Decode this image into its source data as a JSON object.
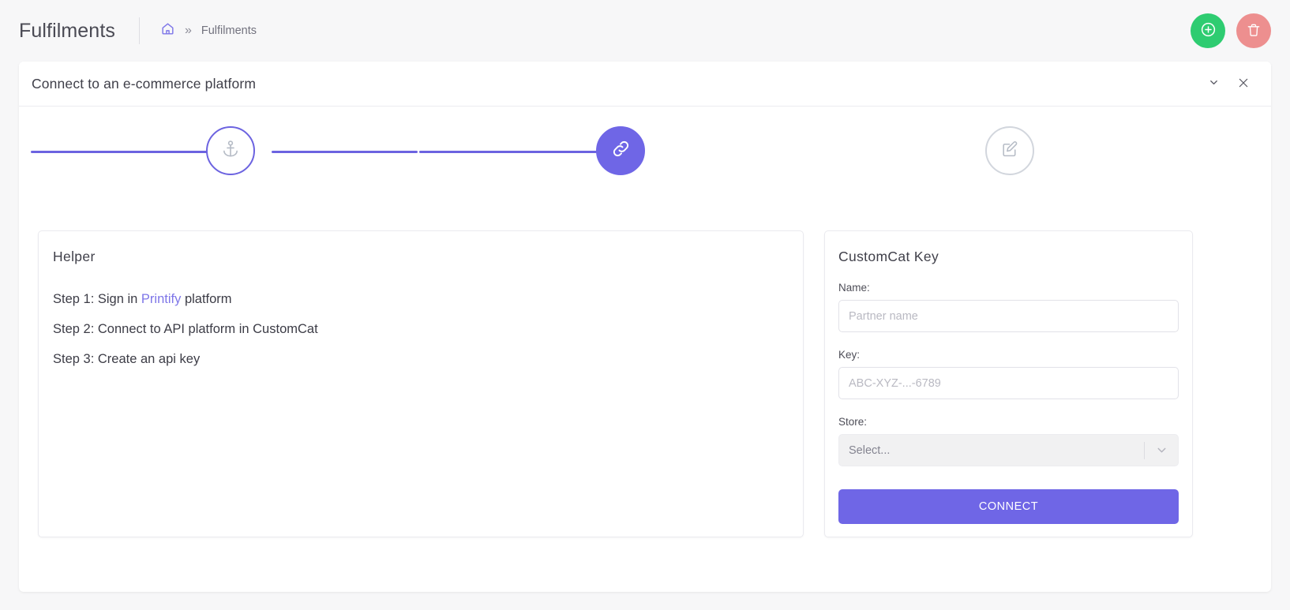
{
  "header": {
    "title": "Fulfilments",
    "breadcrumb": {
      "home_icon": "home-icon",
      "separator": "»",
      "current": "Fulfilments"
    },
    "actions": {
      "add_label": "add-circle-icon",
      "delete_label": "trash-icon"
    }
  },
  "card": {
    "title": "Connect to an e-commerce platform",
    "collapse_icon": "chevron-down-icon",
    "close_icon": "close-icon"
  },
  "stepper": {
    "steps": [
      {
        "id": "step-anchor",
        "icon": "anchor-icon",
        "state": "active-outline"
      },
      {
        "id": "step-link",
        "icon": "link-icon",
        "state": "active-filled"
      },
      {
        "id": "step-edit",
        "icon": "edit-icon",
        "state": "inactive"
      }
    ]
  },
  "helper": {
    "title": "Helper",
    "steps": [
      {
        "prefix": "Step 1: Sign in ",
        "link": "Printify",
        "suffix": " platform"
      },
      {
        "prefix": "Step 2: Connect to API platform in CustomCat",
        "link": "",
        "suffix": ""
      },
      {
        "prefix": "Step 3: Create an api key",
        "link": "",
        "suffix": ""
      }
    ]
  },
  "key_form": {
    "title": "CustomCat Key",
    "name_label": "Name:",
    "name_value": "",
    "name_placeholder": "Partner name",
    "key_label": "Key:",
    "key_value": "",
    "key_placeholder": "ABC-XYZ-...-6789",
    "store_label": "Store:",
    "store_value": "Select...",
    "store_arrow_icon": "chevron-down-icon",
    "connect_label": "CONNECT"
  },
  "colors": {
    "accent_purple": "#6f66e6",
    "link_purple": "#7e76e8",
    "add_green": "#2ecc71",
    "delete_red": "#ed8f8f",
    "page_bg": "#f7f7f8"
  }
}
